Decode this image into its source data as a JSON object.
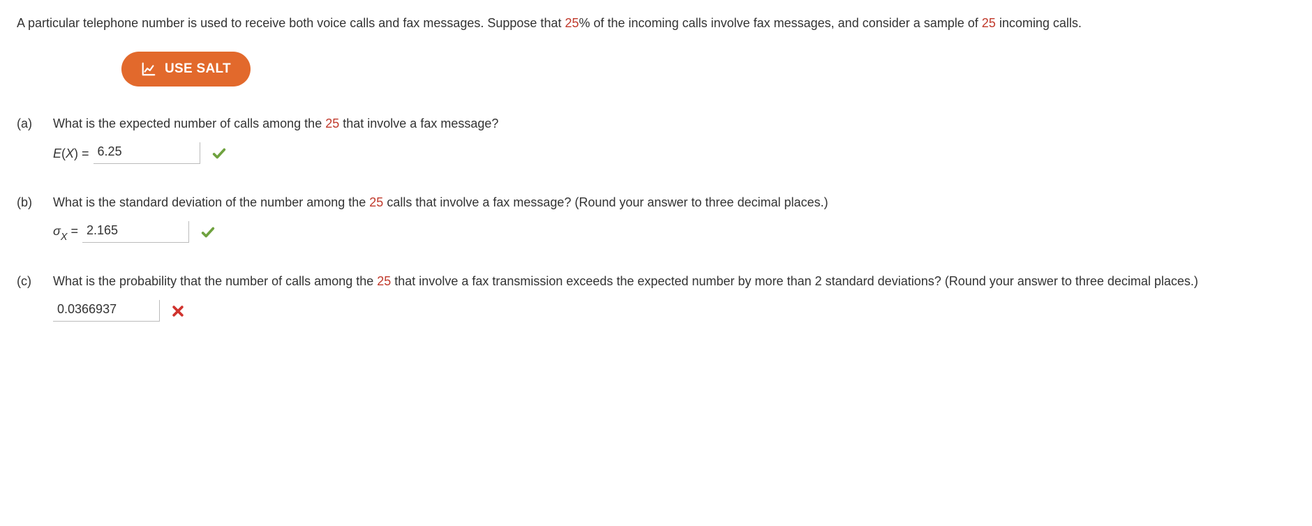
{
  "intro": {
    "t1": "A particular telephone number is used to receive both voice calls and fax messages. Suppose that ",
    "pct": "25",
    "t2": "% of the incoming calls involve fax messages, and consider a sample of ",
    "n": "25",
    "t3": " incoming calls."
  },
  "salt_label": "USE SALT",
  "parts": {
    "a": {
      "label": "(a)",
      "q1": "What is the expected number of calls among the ",
      "qn": "25",
      "q2": " that involve a fax message?",
      "prefix_left": "E",
      "prefix_mid": "(",
      "prefix_var": "X",
      "prefix_right": ")  = ",
      "value": "6.25",
      "correct": true
    },
    "b": {
      "label": "(b)",
      "q1": "What is the standard deviation of the number among the ",
      "qn": "25",
      "q2": " calls that involve a fax message? (Round your answer to three decimal places.)",
      "sigma": "σ",
      "sub": "X",
      "eq": " = ",
      "value": "2.165",
      "correct": true
    },
    "c": {
      "label": "(c)",
      "q1": "What is the probability that the number of calls among the ",
      "qn": "25",
      "q2": " that involve a fax transmission exceeds the expected number by more than 2 standard deviations? (Round your answer to three decimal places.)",
      "value": "0.0366937",
      "correct": false
    }
  }
}
